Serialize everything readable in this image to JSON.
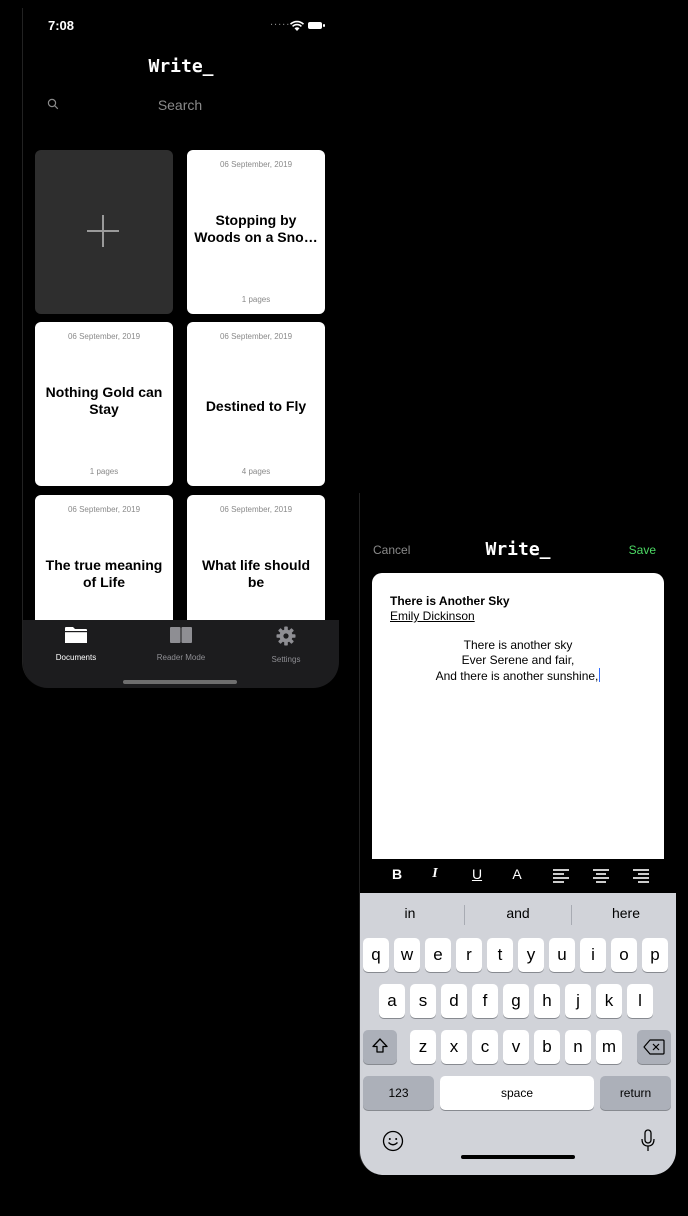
{
  "left_screen": {
    "status": {
      "time": "7:08",
      "dots": "....."
    },
    "title": "Write_",
    "search": {
      "placeholder": "Search"
    },
    "cards": [
      {
        "date": "06 September, 2019",
        "title": "Stopping by Woods on a Sno…",
        "pages": "1 pages"
      },
      {
        "date": "06 September, 2019",
        "title": "Nothing Gold can Stay",
        "pages": "1 pages"
      },
      {
        "date": "06 September, 2019",
        "title": "Destined to Fly",
        "pages": "4 pages"
      },
      {
        "date": "06 September, 2019",
        "title": "The true meaning of Life",
        "pages": ""
      },
      {
        "date": "06 September, 2019",
        "title": "What life should be",
        "pages": ""
      }
    ],
    "tabs": [
      {
        "label": "Documents",
        "icon": "folder-icon",
        "color": "#ffffff"
      },
      {
        "label": "Reader Mode",
        "icon": "book-icon",
        "color": "#8e8e93"
      },
      {
        "label": "Settings",
        "icon": "gear-icon",
        "color": "#8e8e93"
      }
    ]
  },
  "editor": {
    "cancel": "Cancel",
    "title": "Write_",
    "save": "Save",
    "save_color": "#4cd964",
    "doc_title": "There is Another Sky",
    "doc_author": "Emily Dickinson",
    "lines": [
      "There is another sky",
      "Ever Serene and fair,",
      "And there is another sunshine,"
    ],
    "format": [
      "B",
      "I",
      "U",
      "A",
      "align-left-icon",
      "align-center-icon",
      "align-right-icon"
    ]
  },
  "keyboard": {
    "suggestions": [
      "in",
      "and",
      "here"
    ],
    "row1": [
      "q",
      "w",
      "e",
      "r",
      "t",
      "y",
      "u",
      "i",
      "o",
      "p"
    ],
    "row2": [
      "a",
      "s",
      "d",
      "f",
      "g",
      "h",
      "j",
      "k",
      "l"
    ],
    "row3": [
      "z",
      "x",
      "c",
      "v",
      "b",
      "n",
      "m"
    ],
    "numbers": "123",
    "space": "space",
    "return": "return"
  }
}
